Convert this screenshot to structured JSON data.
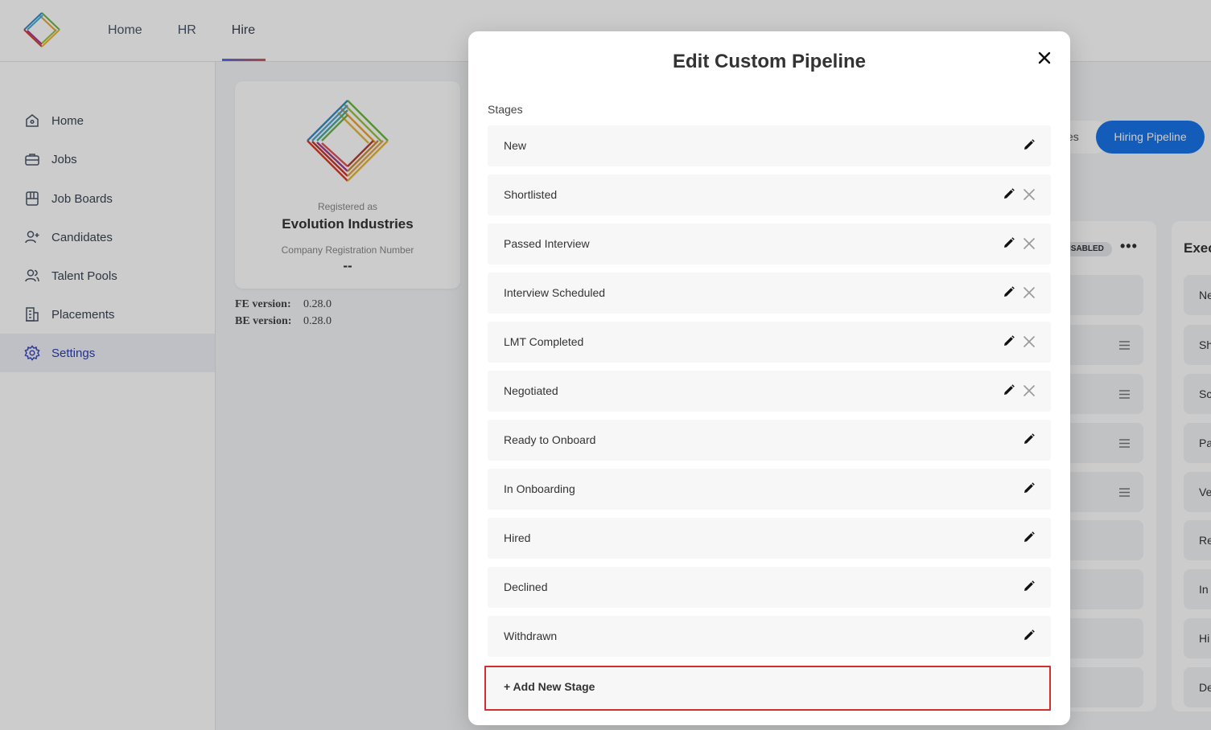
{
  "topnav": {
    "items": [
      "Home",
      "HR",
      "Hire"
    ],
    "active_index": 2
  },
  "sidebar": {
    "items": [
      {
        "label": "Home",
        "icon": "home-icon"
      },
      {
        "label": "Jobs",
        "icon": "briefcase-icon"
      },
      {
        "label": "Job Boards",
        "icon": "job-board-icon"
      },
      {
        "label": "Candidates",
        "icon": "user-plus-icon"
      },
      {
        "label": "Talent Pools",
        "icon": "users-icon"
      },
      {
        "label": "Placements",
        "icon": "building-icon"
      },
      {
        "label": "Settings",
        "icon": "gear-icon"
      }
    ],
    "active_index": 6
  },
  "company": {
    "registered_as_label": "Registered as",
    "name": "Evolution Industries",
    "registration_label": "Company Registration Number",
    "registration_number": "--"
  },
  "versions": {
    "fe_label": "FE version:",
    "fe_value": "0.28.0",
    "be_label": "BE version:",
    "be_value": "0.28.0"
  },
  "background_panel": {
    "tab_partial": "es",
    "active_tab": "Hiring Pipeline",
    "badge_partial": "ISABLED",
    "more_icon": "more-horizontal-icon",
    "column_title_partial": "Exec",
    "column_rows_partial": [
      "Ne",
      "Sh",
      "Sc",
      "Pa",
      "Ve",
      "Re",
      "In",
      "Hi",
      "De"
    ]
  },
  "modal": {
    "title": "Edit Custom Pipeline",
    "close_icon": "close-icon",
    "stages_label": "Stages",
    "stages": [
      {
        "name": "New",
        "removable": false
      },
      {
        "name": "Shortlisted",
        "removable": true
      },
      {
        "name": "Passed Interview",
        "removable": true
      },
      {
        "name": "Interview Scheduled",
        "removable": true
      },
      {
        "name": "LMT Completed",
        "removable": true
      },
      {
        "name": "Negotiated",
        "removable": true
      },
      {
        "name": "Ready to Onboard",
        "removable": false
      },
      {
        "name": "In Onboarding",
        "removable": false
      },
      {
        "name": "Hired",
        "removable": false
      },
      {
        "name": "Declined",
        "removable": false
      },
      {
        "name": "Withdrawn",
        "removable": false
      }
    ],
    "add_stage_label": "+ Add New Stage"
  },
  "colors": {
    "accent": "#1a73e8",
    "highlight_border": "#d32f2f",
    "active_sidebar_text": "#2d3eaa"
  }
}
